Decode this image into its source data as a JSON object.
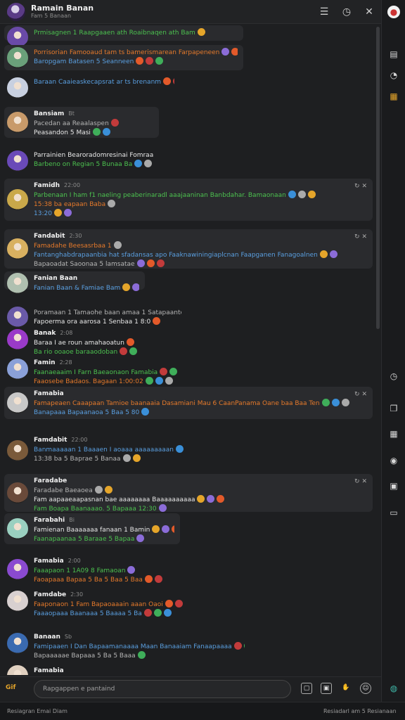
{
  "header": {
    "title": "Ramain Banan",
    "subtitle": "Fam 5 Banaan"
  },
  "input": {
    "placeholder": "Rapgappen e pantaind",
    "gif_label": "Gif"
  },
  "status": {
    "left": "Resiagran Emai Diam",
    "right": "Resiadarl am 5 Resianaan"
  },
  "messages": [
    {
      "name": "",
      "meta": "",
      "lines": [
        "Prmisagnen 1 Raapgaaen ath Roaibnaqen ath Bam"
      ]
    },
    {
      "name": "",
      "meta": "",
      "lines": [
        "Porrisorian Famooaud tam ts bamerismarean Farpapeneen",
        "Baropgam Batasen 5 Seanneen"
      ]
    },
    {
      "name": "",
      "meta": "",
      "lines": [
        "Baraan Caaieaskecapsrat ar ts brenanm"
      ]
    },
    {
      "name": "Bansiam",
      "meta": "Bt",
      "lines": [
        "Pacedan aa Reaalaspen",
        "Peasandon 5 Masi"
      ]
    },
    {
      "name": "",
      "meta": "",
      "lines": [
        "Parrainien Bearoradomresinai Fomraaien",
        "Barbeno on Regian 5 Bunaa Ba"
      ]
    },
    {
      "name": "Famidh",
      "meta": "22:00",
      "lines": [
        "Parbenaan I ham f1 naeling peaberinaradl aaajaaninan Banbdahar. Bamaonaan",
        "15:38 ba eapaan Baba",
        "13:20"
      ]
    },
    {
      "name": "Fandabit",
      "meta": "2:30",
      "lines": [
        "Famadahe Beesasrbaa 1",
        "Fantanghabdrapaanbia hat sfadansas apo Faaknawiningiaplcnan Faapganen Fanagoalnen",
        "Bapaoadat Saoonaa 5 lamsatae"
      ]
    },
    {
      "name": "Fanian Baan",
      "meta": "",
      "lines": [
        "Fanian Baan & Famiae Bam"
      ]
    },
    {
      "name": "",
      "meta": "",
      "lines": [
        "Poramaan 1 Tamaohe baan amaa 1 Satapaanteen",
        "Fapoerma ora aarosa 1 Senbaa 1 8:0"
      ]
    },
    {
      "name": "Banak",
      "meta": "2:08",
      "lines": [
        "Baraa I ae roun amahaoatun",
        "Ba rio ooaoe baraaodoban"
      ]
    },
    {
      "name": "Famin",
      "meta": "2:28",
      "lines": [
        "Faanaeaaim I Farn Baeaonaon Famabia",
        "Faaosebe Badaos. Bagaan 1:00:02"
      ]
    },
    {
      "name": "Famabia",
      "meta": "",
      "lines": [
        "Famapeaen Caaapaan Tamioe baanaaia Dasamiani Mau 6 CaanPanama Oane baa Baa Ten",
        "Banapaaa Bapaanaoa 5 Baa 5 80"
      ]
    },
    {
      "name": "Famdabit",
      "meta": "22:00",
      "lines": [
        "Banmaaaaan 1 Baaaen I aoaaa aaaaaaaaan",
        "13:38 ba 5 Baprae 5 Banaa"
      ]
    },
    {
      "name": "Faradabe",
      "meta": "",
      "lines": [
        "Faradabe Baeaoea",
        "Fam aapaaeaapasnan bae aaaaaaaa Baaaaaaaaaa",
        "Fam Boapa Baanaaao. 5 Bapaaa 12:30"
      ]
    },
    {
      "name": "Farabahi",
      "meta": "Bi",
      "lines": [
        "Famienan Baaaaaaa fanaan 1 Bamin",
        "Faanapaanaa 5 Baraae 5 Bapaa"
      ]
    },
    {
      "name": "Famabia",
      "meta": "2:00",
      "lines": [
        "Faaapaon 1 1A09 8 Famaoan",
        "Faoapaaa Bapaa 5 Ba 5 Baa 5 Baa"
      ]
    },
    {
      "name": "Famdabe",
      "meta": "2:30",
      "lines": [
        "Faaponaon 1 Fam Bapaoaaain aaan Oaoi",
        "Faaaopaaa Baanaaa 5 Baaaa 5 Ba"
      ]
    },
    {
      "name": "Banaan",
      "meta": "Sb",
      "lines": [
        "Famipaaen I Dan Bapaamanaaaa Maan Banaaiam Fanaapaaaa",
        "Bapaaaaae Bapaaa 5 Ba 5 Baaa"
      ]
    },
    {
      "name": "Famabia",
      "meta": "",
      "lines": [
        "Famabia Baaaa 5 Baaa"
      ]
    }
  ]
}
